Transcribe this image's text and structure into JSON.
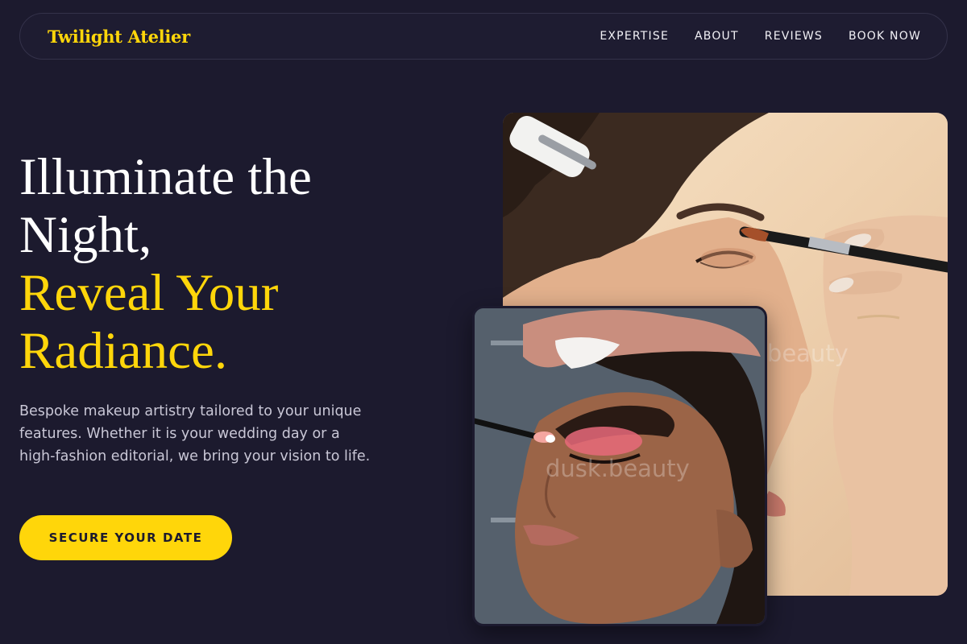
{
  "brand": {
    "name": "Twilight Atelier"
  },
  "nav": {
    "links": [
      "EXPERTISE",
      "ABOUT",
      "REVIEWS",
      "BOOK NOW"
    ]
  },
  "hero": {
    "headline_line1": "Illuminate the",
    "headline_line2": "Night,",
    "headline_line3": "Reveal Your",
    "headline_line4": "Radiance.",
    "description": "Bespoke makeup artistry tailored to your unique features. Whether it is your wedding day or a high-fashion editorial, we bring your vision to life.",
    "cta_label": "SECURE YOUR DATE"
  },
  "images": {
    "back_alt": "Makeup artist applying eyeshadow with a brush",
    "front_alt": "Model with pink eyeshadow having makeup applied",
    "watermark": "dusk.beauty"
  },
  "colors": {
    "background": "#1c1a2e",
    "accent": "#ffd60a",
    "text_muted": "#c9c7d6"
  }
}
